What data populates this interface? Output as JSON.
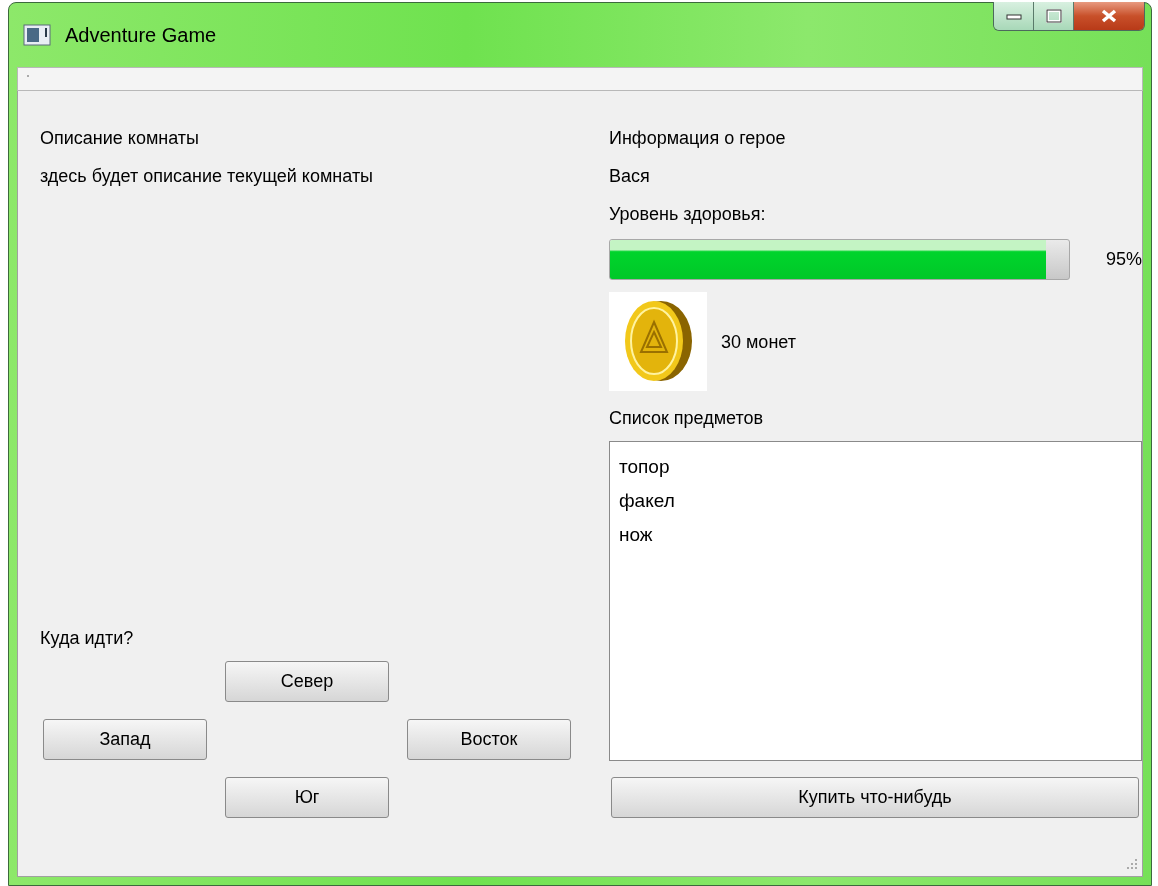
{
  "window": {
    "title": "Adventure Game"
  },
  "room": {
    "heading": "Описание комнаты",
    "description": "здесь будет описание текущей комнаты"
  },
  "navigation": {
    "prompt": "Куда идти?",
    "buttons": [
      {
        "label": "Север",
        "kind": "north"
      },
      {
        "label": "Запад",
        "kind": "west"
      },
      {
        "label": "Восток",
        "kind": "east"
      },
      {
        "label": "Юг",
        "kind": "south"
      }
    ]
  },
  "hero": {
    "heading": "Информация о герое",
    "name": "Вася",
    "health_label": "Уровень здоровья:",
    "health": {
      "level": 0.95,
      "reading": "95%"
    },
    "coins": "30 монет",
    "items_label": "Список предметов",
    "items": [
      "топор",
      "факел",
      "нож"
    ],
    "buy_button": "Купить что-нибудь"
  }
}
